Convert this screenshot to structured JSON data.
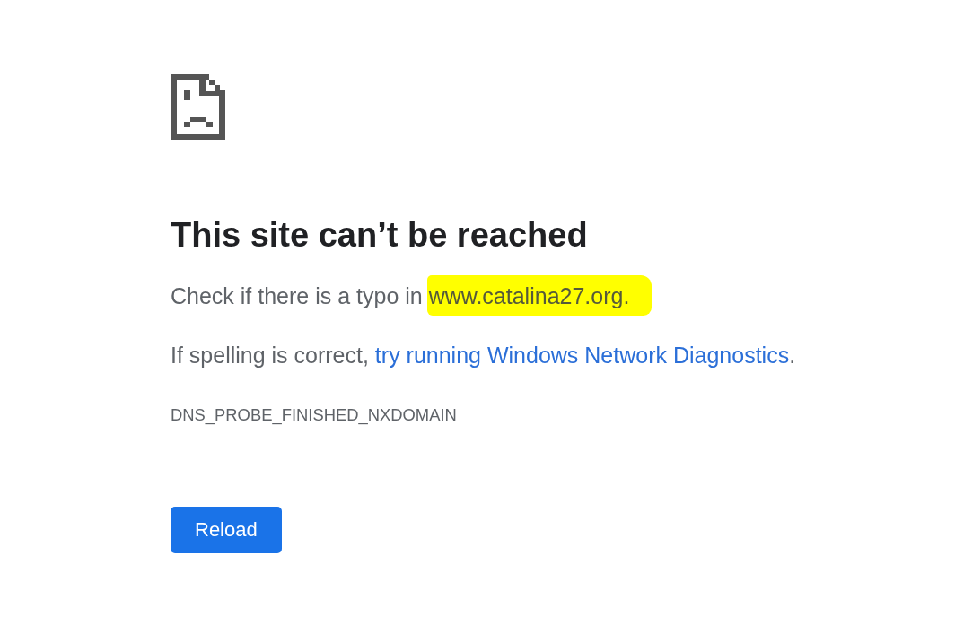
{
  "heading": "This site can’t be reached",
  "typo_hint": {
    "text": "Check if there is a typo in",
    "url": "www.catalina27.org.",
    "highlighted": true
  },
  "spelling_hint": {
    "text": "If spelling is correct,",
    "link": "try running Windows Network Diagnostics",
    "suffix": "."
  },
  "error_code": "DNS_PROBE_FINISHED_NXDOMAIN",
  "button": {
    "label": "Reload"
  }
}
